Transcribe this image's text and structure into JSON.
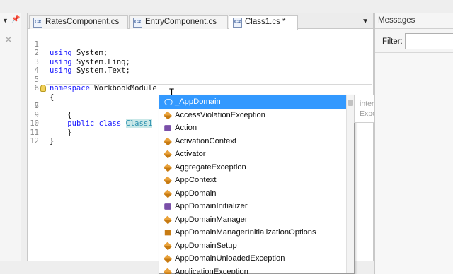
{
  "tabs": [
    {
      "label": "RatesComponent.cs"
    },
    {
      "label": "EntryComponent.cs"
    },
    {
      "label": "Class1.cs *"
    }
  ],
  "code_lines": [
    {
      "num": "1",
      "text": "using System;"
    },
    {
      "num": "2",
      "text": "using System.Linq;"
    },
    {
      "num": "3",
      "text": "using System.Text;"
    },
    {
      "num": "4",
      "text": ""
    },
    {
      "num": "5",
      "text": "namespace WorkbookModule"
    },
    {
      "num": "6",
      "text": "{"
    },
    {
      "num": "7",
      "text": "    public class Class1 : "
    },
    {
      "num": "8",
      "text": "    {"
    },
    {
      "num": "9",
      "text": ""
    },
    {
      "num": "10",
      "text": "    }"
    },
    {
      "num": "11",
      "text": "}"
    },
    {
      "num": "12",
      "text": ""
    }
  ],
  "completion": {
    "items": [
      {
        "label": "_AppDomain",
        "icon": "interface-icon"
      },
      {
        "label": "AccessViolationException",
        "icon": "class-icon"
      },
      {
        "label": "Action",
        "icon": "delegate-icon"
      },
      {
        "label": "ActivationContext",
        "icon": "class-icon"
      },
      {
        "label": "Activator",
        "icon": "class-icon"
      },
      {
        "label": "AggregateException",
        "icon": "class-icon"
      },
      {
        "label": "AppContext",
        "icon": "class-icon"
      },
      {
        "label": "AppDomain",
        "icon": "class-icon"
      },
      {
        "label": "AppDomainInitializer",
        "icon": "delegate-icon"
      },
      {
        "label": "AppDomainManager",
        "icon": "class-icon"
      },
      {
        "label": "AppDomainManagerInitializationOptions",
        "icon": "enum-icon"
      },
      {
        "label": "AppDomainSetup",
        "icon": "class-icon"
      },
      {
        "label": "AppDomainUnloadedException",
        "icon": "class-icon"
      },
      {
        "label": "ApplicationException",
        "icon": "class-icon"
      }
    ],
    "selected_index": 0
  },
  "tooltip": {
    "line1": "interface System._AppDoma",
    "line2": "Exposes the public member"
  },
  "messages": {
    "title": "Messages",
    "filter_label": "Filter:",
    "filter_value": ""
  },
  "colors": {
    "keyword": "#1a1aff",
    "type": "#2b91af",
    "selection": "#3399ff"
  }
}
